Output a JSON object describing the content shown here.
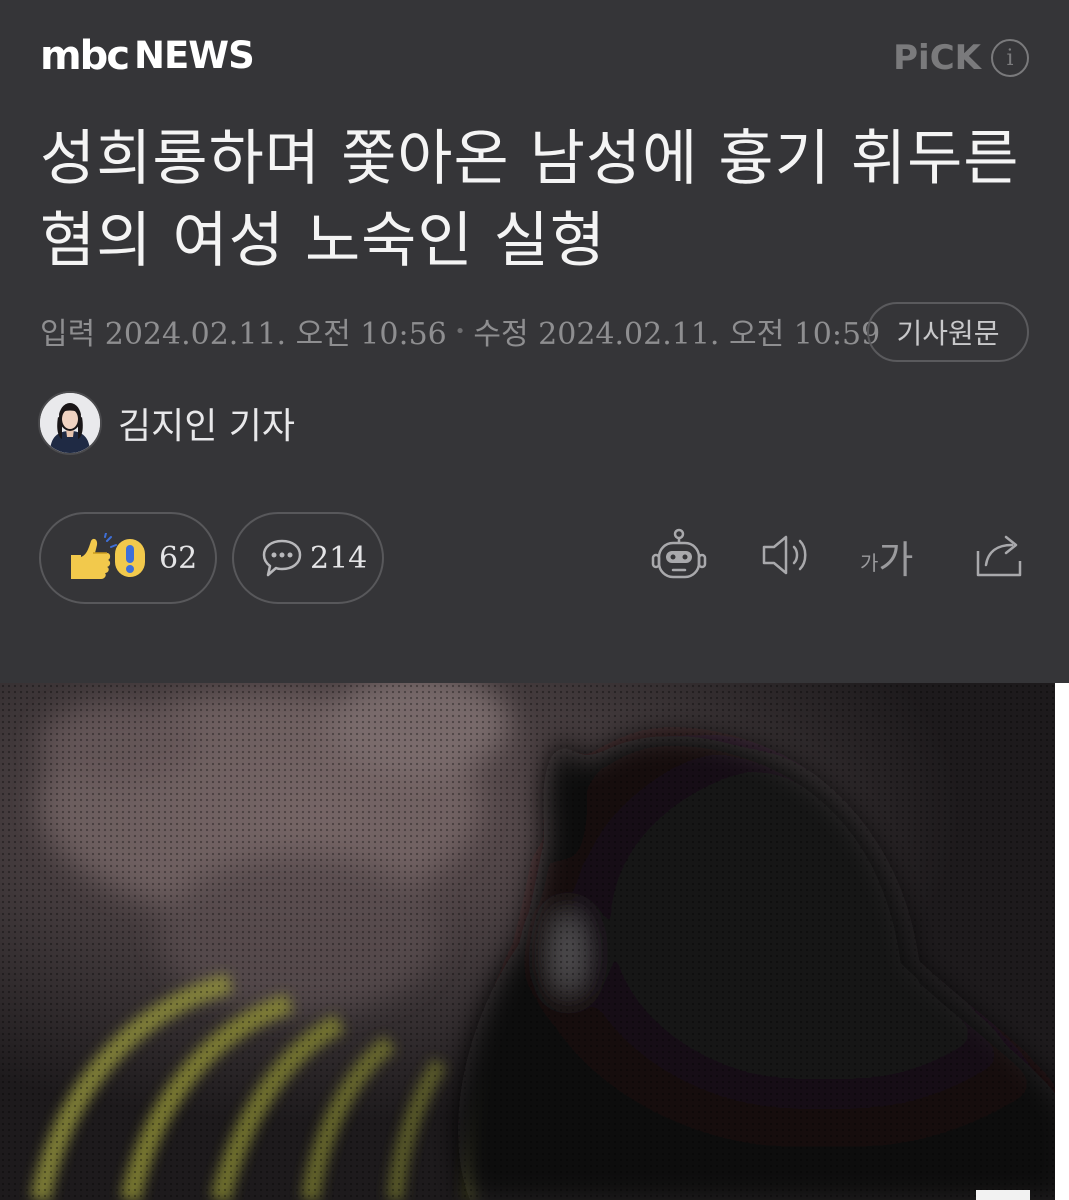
{
  "header": {
    "logo_mbc": "mbc",
    "logo_news": "NEWS",
    "pick_label": "PiCK",
    "pick_info_symbol": "i"
  },
  "article": {
    "title": "성희롱하며 쫓아온 남성에 흉기 휘두른 혐의 여성 노숙인 실형",
    "published_label": "입력 2024.02.11. 오전 10:56",
    "separator": "•",
    "modified_label": "수정 2024.02.11. 오전 10:59",
    "origin_button": "기사원문",
    "reporter": "김지인 기자"
  },
  "actions": {
    "reactions_count": "62",
    "comments_count": "214",
    "font_small": "가",
    "font_large": "가"
  },
  "icons": {
    "reaction": "thumbs-up-and-exclamation-icon",
    "comment": "speech-bubble-icon",
    "summary_bot": "robot-icon",
    "audio": "speaker-icon",
    "share": "share-icon",
    "info": "info-icon"
  },
  "colors": {
    "background": "#353538",
    "text_primary": "#f4f4f4",
    "text_muted": "#8e8e90",
    "border": "#58585b",
    "reaction_yellow": "#f2c94c",
    "reaction_blue": "#3e6fd8"
  }
}
